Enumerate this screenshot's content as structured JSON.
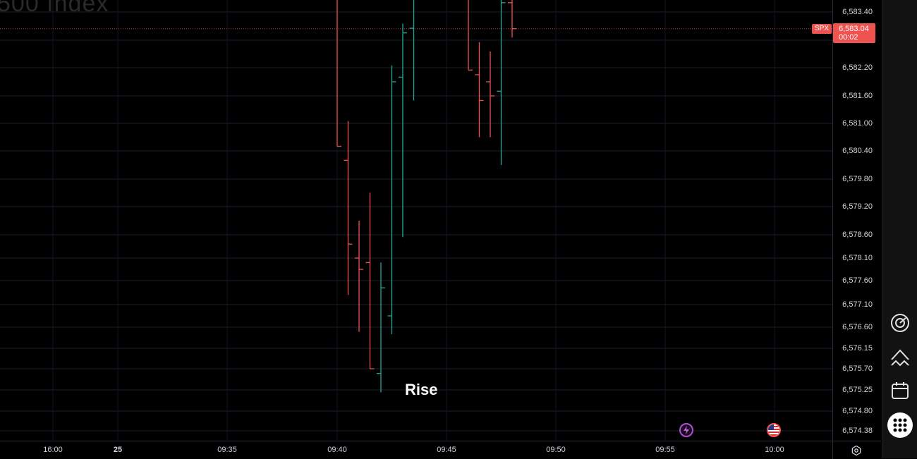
{
  "chart_title_partial": "500 Index",
  "current_price": {
    "symbol": "SPX",
    "price": "6,583.04",
    "countdown": "00:02",
    "color": "#ef5350"
  },
  "overlay_label": "Rise",
  "colors": {
    "up": "#26a69a",
    "down": "#ef5350",
    "background": "#000000",
    "grid": "#1c2030"
  },
  "icons": {
    "toolbar": [
      "radar-icon",
      "pattern-icon",
      "calendar-icon",
      "apps-grid-icon"
    ],
    "settings": "settings-gear-icon"
  },
  "chart_data": {
    "type": "ohlc",
    "title": "500 Index",
    "symbol": "SPX",
    "ylim": [
      6574.2,
      6584.0
    ],
    "y_ticks": [
      "6,583.40",
      "6,582.20",
      "6,581.60",
      "6,581.00",
      "6,580.40",
      "6,579.80",
      "6,579.20",
      "6,578.60",
      "6,578.10",
      "6,577.60",
      "6,577.10",
      "6,576.60",
      "6,576.15",
      "6,575.70",
      "6,575.25",
      "6,574.80",
      "6,574.38"
    ],
    "x_ticks": [
      {
        "label": "16:00",
        "bold": false
      },
      {
        "label": "25",
        "bold": true
      },
      {
        "label": "09:35",
        "bold": false
      },
      {
        "label": "09:40",
        "bold": false
      },
      {
        "label": "09:45",
        "bold": false
      },
      {
        "label": "09:50",
        "bold": false
      },
      {
        "label": "09:55",
        "bold": false
      },
      {
        "label": "10:00",
        "bold": false
      }
    ],
    "bars": [
      {
        "time": "09:40",
        "open": 6584.2,
        "high": 6584.2,
        "low": 6580.5,
        "close": 6580.5
      },
      {
        "time": "09:41",
        "open": 6580.2,
        "high": 6581.05,
        "low": 6577.3,
        "close": 6578.4
      },
      {
        "time": "09:42",
        "open": 6578.1,
        "high": 6578.9,
        "low": 6576.5,
        "close": 6577.85
      },
      {
        "time": "09:43",
        "open": 6578.0,
        "high": 6579.5,
        "low": 6575.7,
        "close": 6575.7
      },
      {
        "time": "09:44",
        "open": 6575.6,
        "high": 6578.0,
        "low": 6575.2,
        "close": 6577.45
      },
      {
        "time": "09:45",
        "open": 6576.85,
        "high": 6582.25,
        "low": 6576.45,
        "close": 6581.9
      },
      {
        "time": "09:46",
        "open": 6582.0,
        "high": 6583.15,
        "low": 6578.55,
        "close": 6582.95
      },
      {
        "time": "09:47",
        "open": 6583.05,
        "high": 6584.5,
        "low": 6581.5,
        "close": 6584.3
      },
      {
        "time": "09:52",
        "open": 6584.3,
        "high": 6584.3,
        "low": 6582.15,
        "close": 6582.15
      },
      {
        "time": "09:53",
        "open": 6582.05,
        "high": 6582.75,
        "low": 6580.7,
        "close": 6581.5
      },
      {
        "time": "09:54",
        "open": 6581.9,
        "high": 6582.55,
        "low": 6580.7,
        "close": 6581.6
      },
      {
        "time": "09:55",
        "open": 6581.7,
        "high": 6584.0,
        "low": 6580.1,
        "close": 6583.6
      },
      {
        "time": "09:56",
        "open": 6583.6,
        "high": 6584.0,
        "low": 6582.85,
        "close": 6583.04
      }
    ],
    "grid": true
  }
}
